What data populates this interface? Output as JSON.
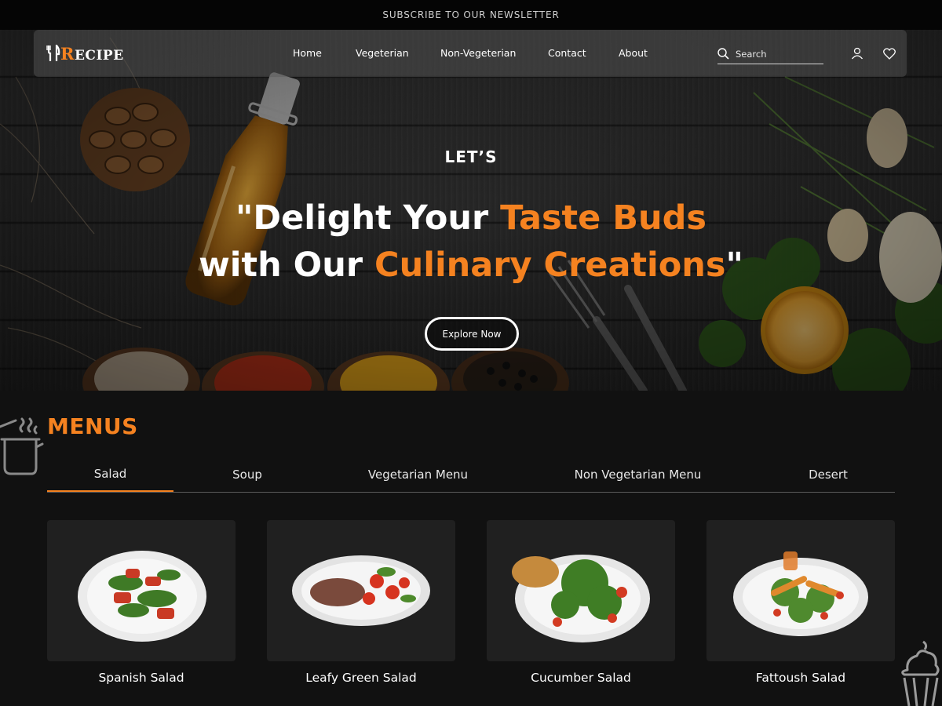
{
  "announcement": "SUBSCRIBE TO OUR NEWSLETTER",
  "brand": {
    "logo_initial": "R",
    "logo_rest": "ECIPE",
    "logo_icon": "fork-knife-icon"
  },
  "nav": {
    "items": [
      {
        "label": "Home"
      },
      {
        "label": "Vegeterian"
      },
      {
        "label": "Non-Vegeterian"
      },
      {
        "label": "Contact"
      },
      {
        "label": "About"
      }
    ]
  },
  "search": {
    "placeholder": "Search",
    "icon": "search-icon"
  },
  "header_icons": [
    "user-icon",
    "heart-icon"
  ],
  "hero": {
    "kicker": "LET’S",
    "line1_a": "\"Delight Your ",
    "line1_b": "Taste Buds",
    "line2_a": "with Our ",
    "line2_b": "Culinary Creations",
    "line2_c": "\"",
    "cta_label": "Explore Now"
  },
  "menus": {
    "title": "MENUS",
    "tabs": [
      {
        "label": "Salad",
        "active": true
      },
      {
        "label": "Soup",
        "active": false
      },
      {
        "label": "Vegetarian Menu",
        "active": false
      },
      {
        "label": "Non Vegetarian Menu",
        "active": false
      },
      {
        "label": "Desert",
        "active": false
      }
    ],
    "items": [
      {
        "name": "Spanish Salad"
      },
      {
        "name": "Leafy Green Salad"
      },
      {
        "name": "Cucumber Salad"
      },
      {
        "name": "Fattoush Salad"
      }
    ]
  },
  "colors": {
    "accent": "#f58220",
    "background": "#111111",
    "card": "#202020"
  }
}
